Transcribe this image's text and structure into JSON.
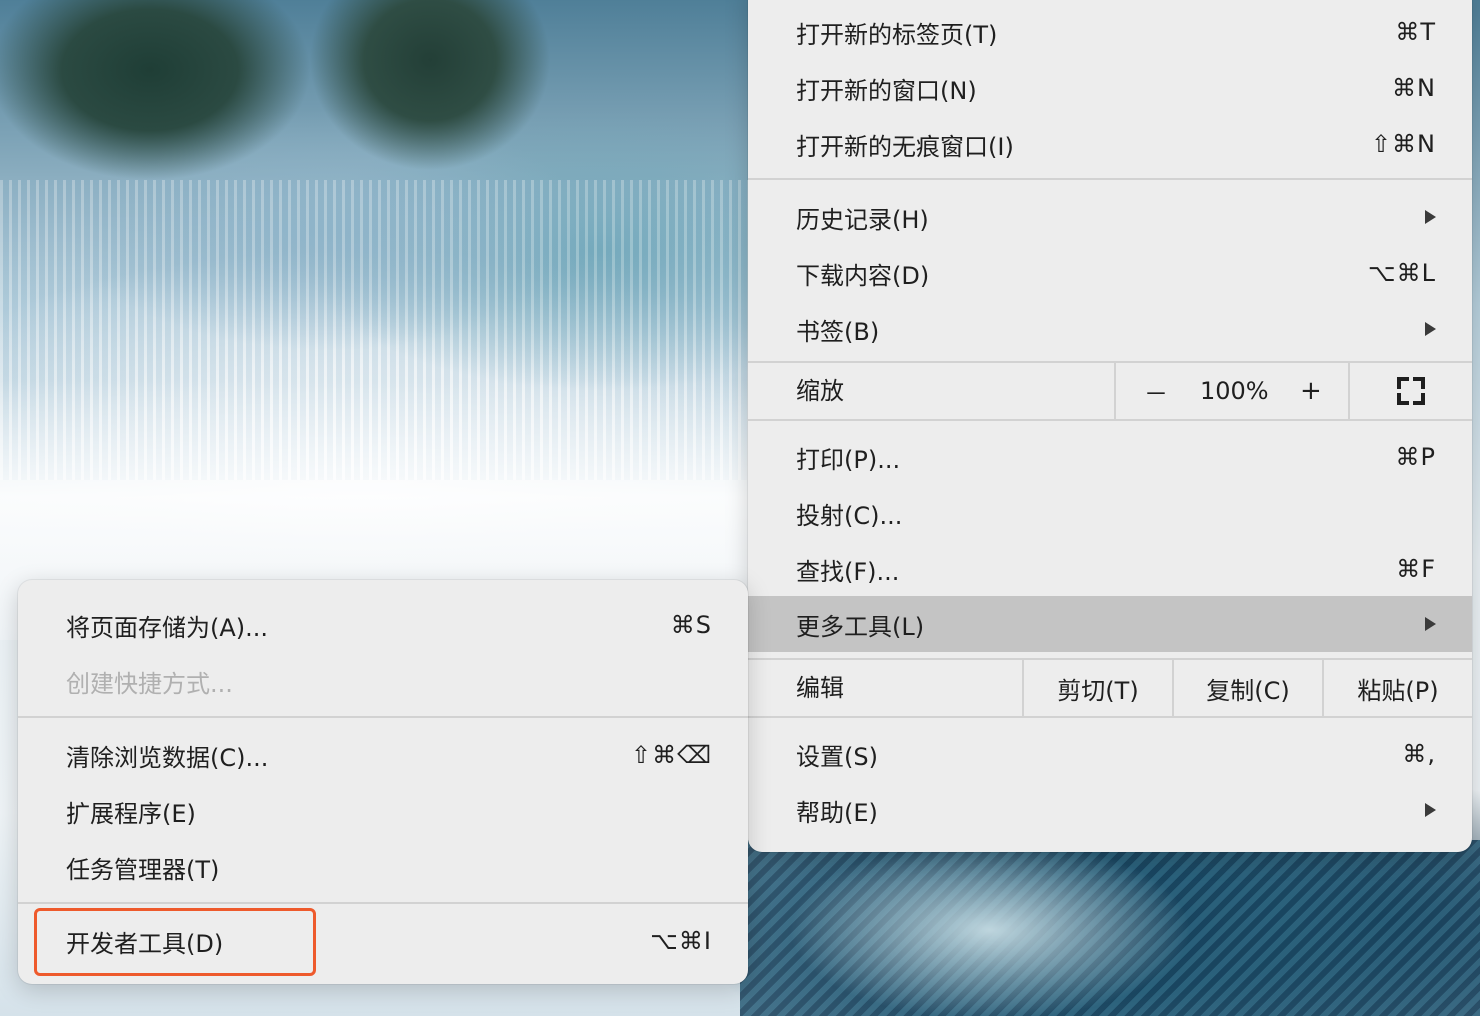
{
  "main_menu": {
    "new_tab": {
      "label": "打开新的标签页(T)",
      "shortcut": "⌘T"
    },
    "new_window": {
      "label": "打开新的窗口(N)",
      "shortcut": "⌘N"
    },
    "new_incognito": {
      "label": "打开新的无痕窗口(I)",
      "shortcut": "⇧⌘N"
    },
    "history": {
      "label": "历史记录(H)"
    },
    "downloads": {
      "label": "下载内容(D)",
      "shortcut": "⌥⌘L"
    },
    "bookmarks": {
      "label": "书签(B)"
    },
    "zoom": {
      "label": "缩放",
      "minus": "－",
      "value": "100%",
      "plus": "+"
    },
    "print": {
      "label": "打印(P)...",
      "shortcut": "⌘P"
    },
    "cast": {
      "label": "投射(C)..."
    },
    "find": {
      "label": "查找(F)...",
      "shortcut": "⌘F"
    },
    "more_tools": {
      "label": "更多工具(L)"
    },
    "edit": {
      "label": "编辑",
      "cut": "剪切(T)",
      "copy": "复制(C)",
      "paste": "粘贴(P)"
    },
    "settings": {
      "label": "设置(S)",
      "shortcut": "⌘,"
    },
    "help": {
      "label": "帮助(E)"
    }
  },
  "sub_menu": {
    "save_page": {
      "label": "将页面存储为(A)...",
      "shortcut": "⌘S"
    },
    "create_shortcut": {
      "label": "创建快捷方式..."
    },
    "clear_data": {
      "label": "清除浏览数据(C)...",
      "shortcut": "⇧⌘⌫"
    },
    "extensions": {
      "label": "扩展程序(E)"
    },
    "task_manager": {
      "label": "任务管理器(T)"
    },
    "developer_tools": {
      "label": "开发者工具(D)",
      "shortcut": "⌥⌘I"
    }
  },
  "colors": {
    "menu_background": "#ededed",
    "highlight_row": "#c4c4c4",
    "annotation_box": "#ee5a2c",
    "disabled_text": "#b0b0b0"
  }
}
